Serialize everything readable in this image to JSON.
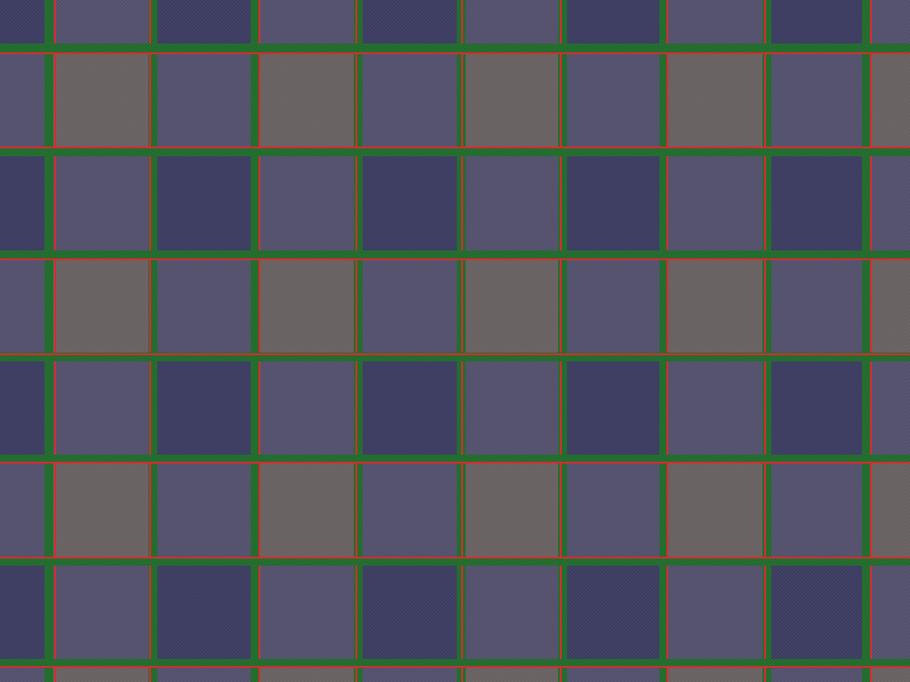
{
  "pattern": {
    "kind": "tartan-plaid",
    "repeat_count_horizontal": 9,
    "repeat_count_vertical": 7
  },
  "colors": {
    "navy": "#3a3a60",
    "grey_mauve": "#686060",
    "navy_grey_mix": "#524f6c",
    "green_stripe": "#1f6a2a",
    "red_stripe": "#d8262a",
    "weave_line_light": "rgba(255,255,255,0.05)",
    "weave_line_dark": "rgba(0,0,0,0.06)"
  }
}
